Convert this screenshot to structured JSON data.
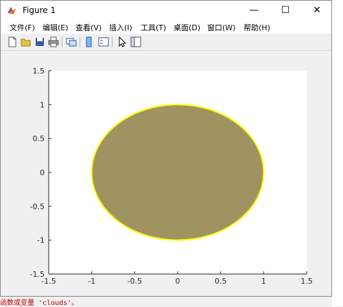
{
  "window": {
    "title": "Figure 1"
  },
  "titlebar_buttons": {
    "minimize": "—",
    "maximize": "☐",
    "close": "✕"
  },
  "menu": [
    "文件(F)",
    "编辑(E)",
    "查看(V)",
    "插入(I)",
    "工具(T)",
    "桌面(D)",
    "窗口(W)",
    "帮助(H)"
  ],
  "toolbar_icons": [
    "new-figure-icon",
    "open-file-icon",
    "save-icon",
    "print-icon",
    "link-icon",
    "colorbar-icon",
    "legend-icon",
    "pointer-icon",
    "property-editor-icon"
  ],
  "background_text": {
    "bottom_line": "函数或变量 'clouds'。"
  },
  "chart_data": {
    "type": "area",
    "title": "",
    "xlabel": "",
    "ylabel": "",
    "xlim": [
      -1.5,
      1.5
    ],
    "ylim": [
      -1.5,
      1.5
    ],
    "xticks": [
      "-1.5",
      "-1",
      "-0.5",
      "0",
      "0.5",
      "1",
      "1.5"
    ],
    "yticks": [
      "-1.5",
      "-1",
      "-0.5",
      "0",
      "0.5",
      "1",
      "1.5"
    ],
    "grid": false,
    "shape": "filled-circle",
    "center": [
      0,
      0
    ],
    "radius": 1,
    "fill_color": "#9f9362",
    "edge_color": "#ffff00"
  }
}
